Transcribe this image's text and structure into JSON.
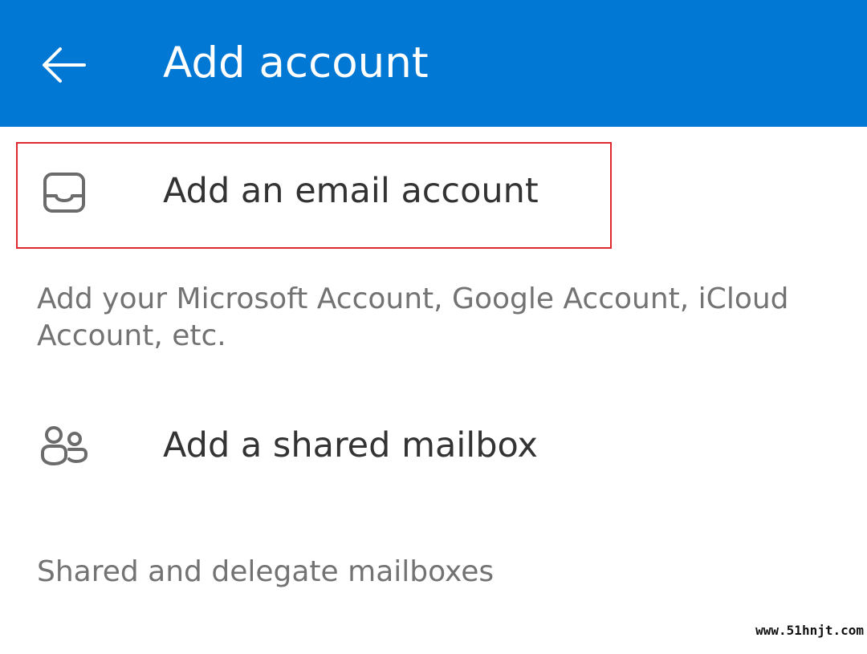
{
  "header": {
    "title": "Add account",
    "back_icon": "arrow-left-icon",
    "background_color": "#0078D4"
  },
  "options": [
    {
      "label": "Add an email account",
      "icon": "inbox-tray-icon",
      "description": "Add your Microsoft Account, Google Account, iCloud Account, etc.",
      "highlighted": true
    },
    {
      "label": "Add a shared mailbox",
      "icon": "people-icon",
      "description": "Shared and delegate mailboxes",
      "highlighted": false
    }
  ],
  "highlight_color": "#E0282F",
  "watermark": "www.51hnjt.com"
}
